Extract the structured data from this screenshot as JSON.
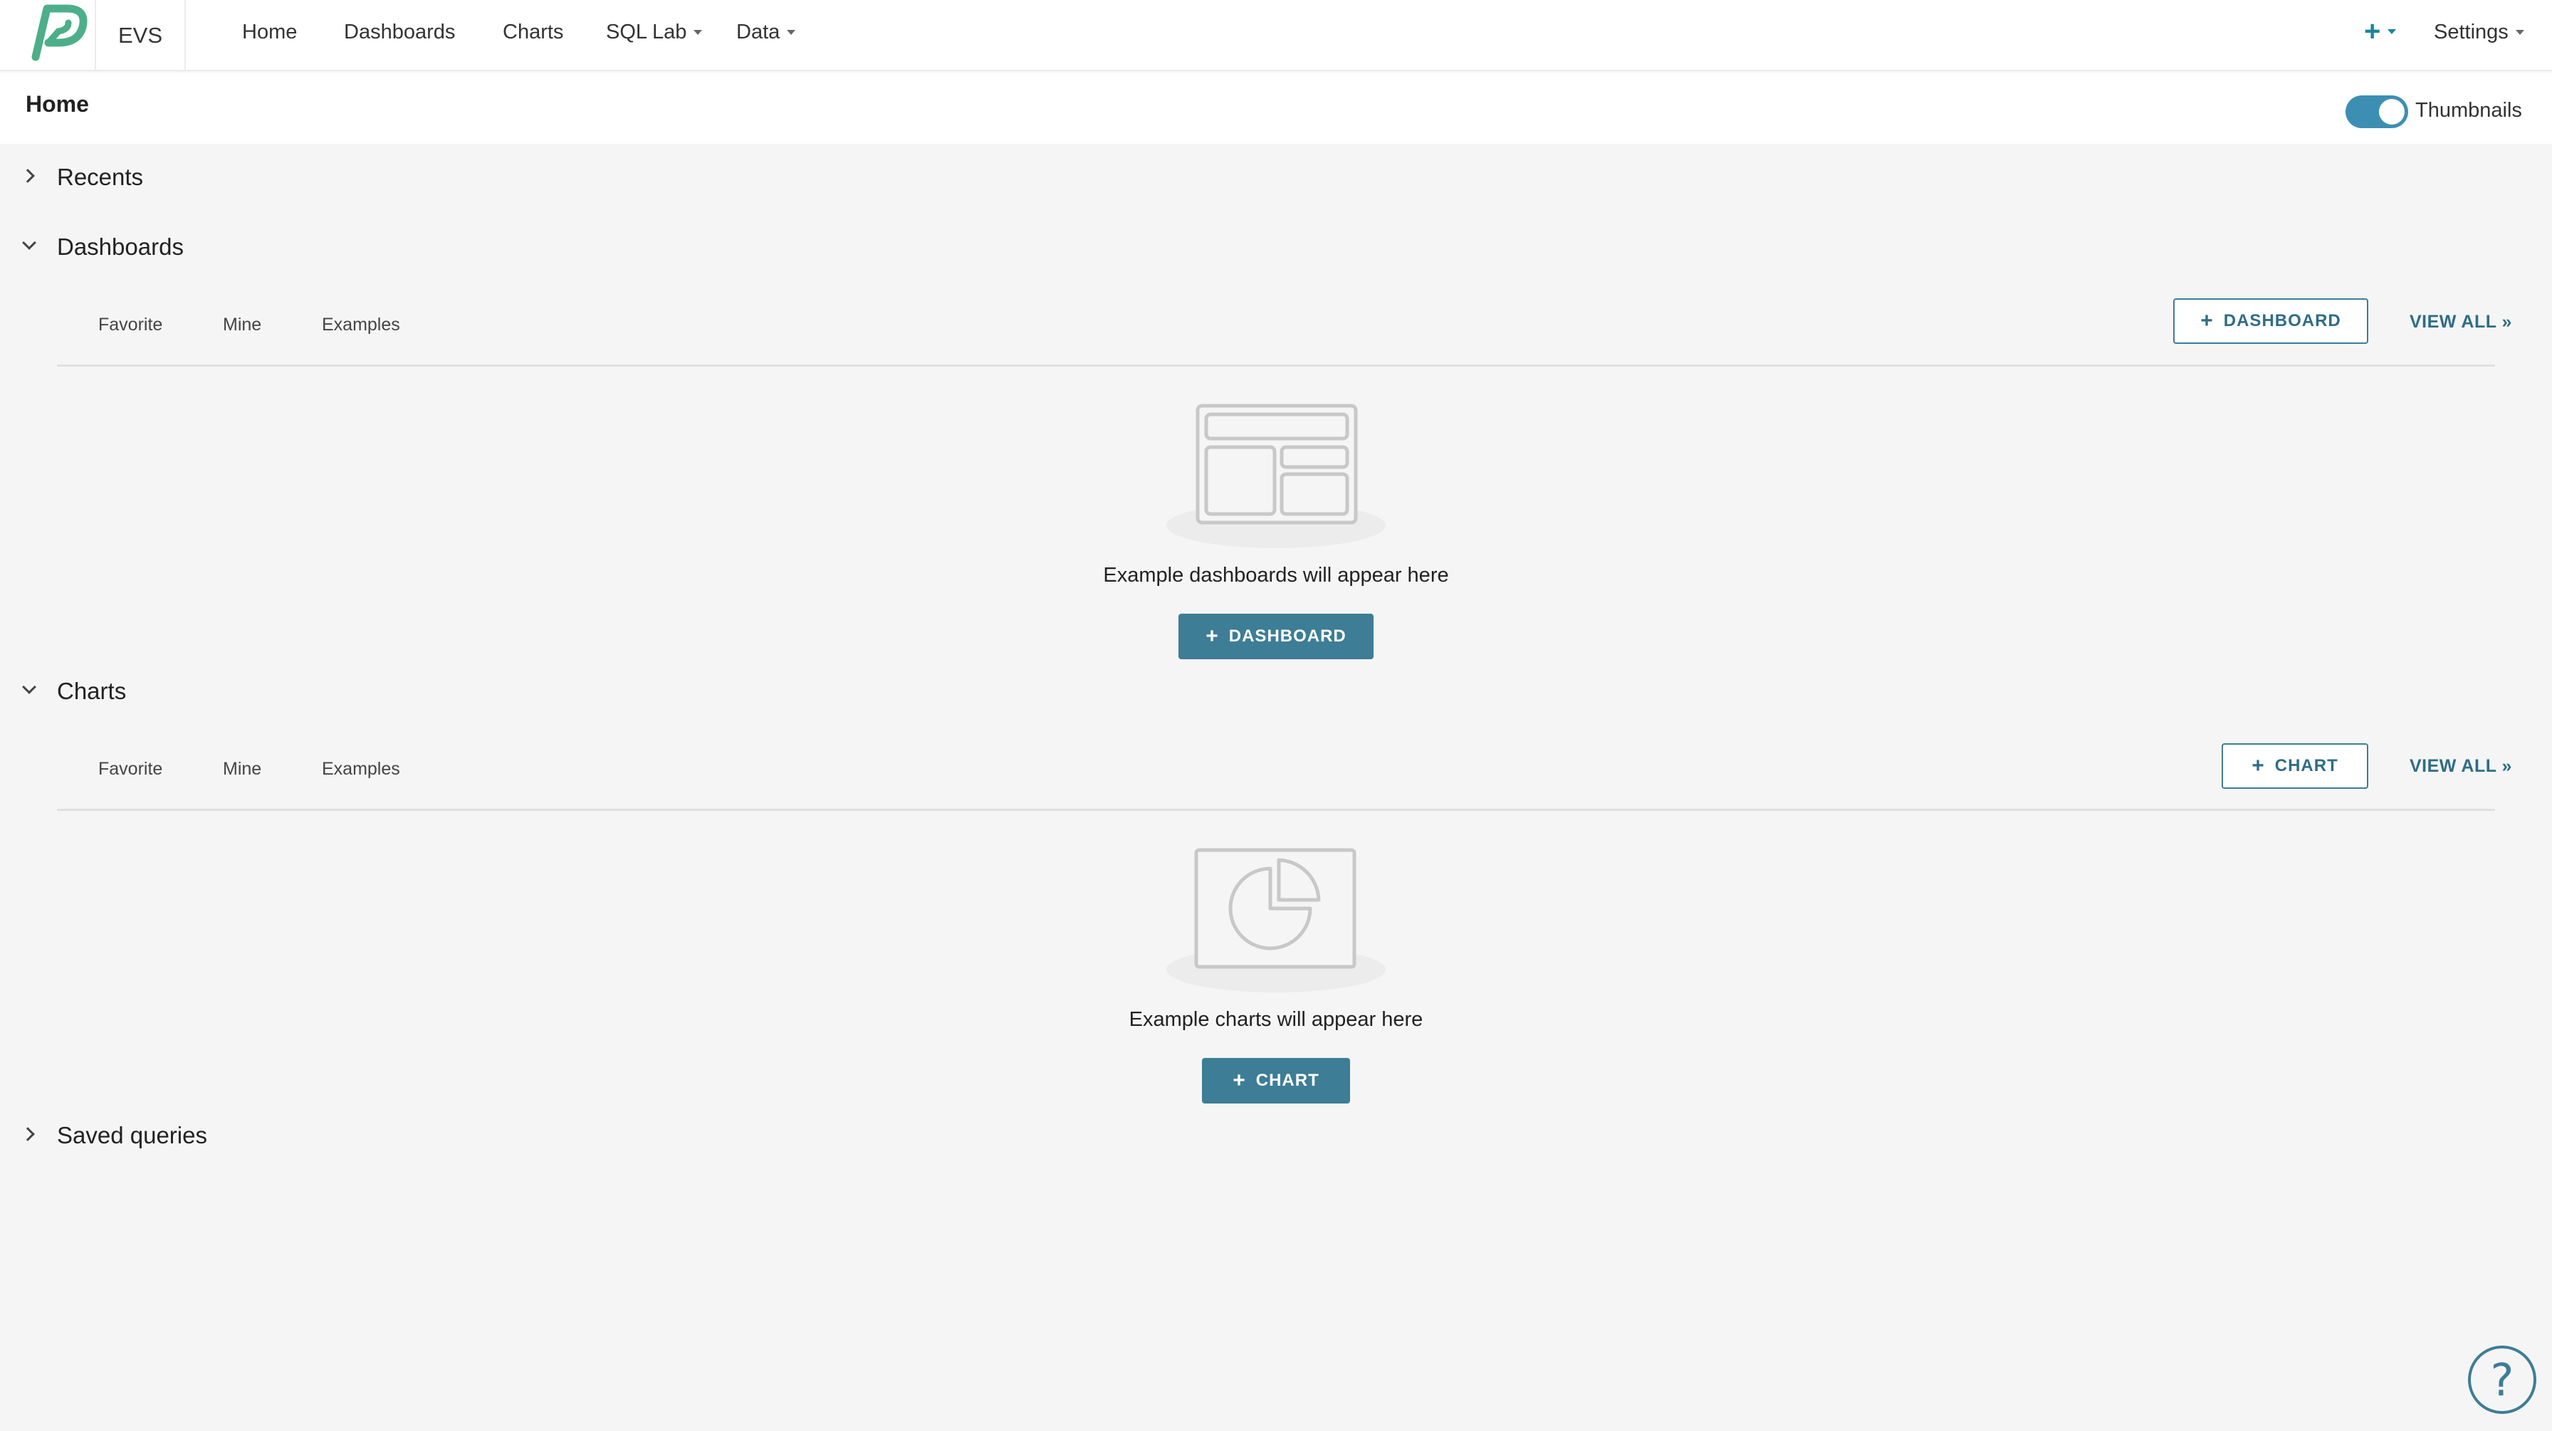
{
  "app": {
    "brand": "EVS",
    "nav": [
      {
        "label": "Home"
      },
      {
        "label": "Dashboards"
      },
      {
        "label": "Charts"
      },
      {
        "label": "SQL Lab"
      },
      {
        "label": "Data"
      }
    ],
    "plus_label": "+",
    "settings_label": "Settings",
    "accent_color": "#3d7d96",
    "logo_color": "#4caf8a"
  },
  "page": {
    "title": "Home",
    "thumbnails_label": "Thumbnails",
    "thumbnails_on": true
  },
  "sections": {
    "recents": {
      "title": "Recents",
      "expanded": false
    },
    "dashboards": {
      "title": "Dashboards",
      "expanded": true,
      "tabs": [
        "Favorite",
        "Mine",
        "Examples"
      ],
      "add_label": "DASHBOARD",
      "view_all": "VIEW ALL »",
      "empty_message": "Example dashboards will appear here",
      "empty_button": "DASHBOARD"
    },
    "charts": {
      "title": "Charts",
      "expanded": true,
      "tabs": [
        "Favorite",
        "Mine",
        "Examples"
      ],
      "add_label": "CHART",
      "view_all": "VIEW ALL »",
      "empty_message": "Example charts will appear here",
      "empty_button": "CHART"
    },
    "saved_queries": {
      "title": "Saved queries",
      "expanded": false
    }
  },
  "help": {
    "label": "?"
  }
}
